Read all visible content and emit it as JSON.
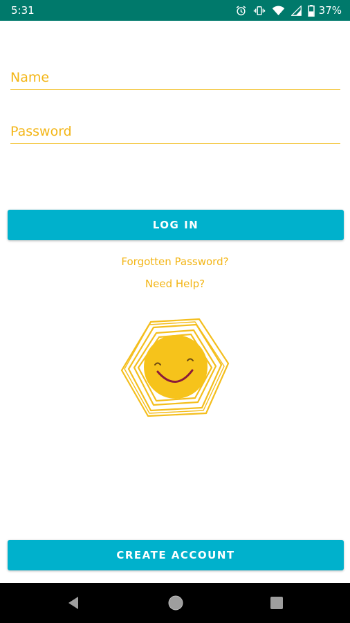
{
  "status_bar": {
    "time": "5:31",
    "battery": "37%",
    "icons": [
      "alarm-icon",
      "vibrate-icon",
      "wifi-icon",
      "cell-signal-icon",
      "battery-icon"
    ]
  },
  "form": {
    "name_placeholder": "Name",
    "password_placeholder": "Password",
    "login_label": "LOG IN",
    "forgot_label": "Forgotten Password?",
    "help_label": "Need Help?",
    "create_account_label": "CREATE ACCOUNT"
  },
  "nav_bar": {
    "buttons": [
      "back-icon",
      "home-icon",
      "recents-icon"
    ]
  },
  "colors": {
    "status_bar": "#00796b",
    "accent_yellow": "#f3b515",
    "button": "#00b1cc",
    "logo_face": "#f6c31b",
    "smile": "#8b1a3a"
  }
}
